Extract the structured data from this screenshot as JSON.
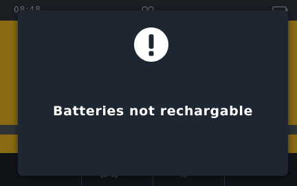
{
  "status_bar": {
    "time": "08:48",
    "icons": [
      "link-icon",
      "battery-icon"
    ]
  },
  "modal": {
    "icon": "exclamation-icon",
    "message": "Batteries not rechargable"
  },
  "colors": {
    "modal_background": "#1e2631",
    "icon_circle": "#ffffff",
    "icon_glyph": "#1e2631",
    "message_text": "#ffffff",
    "dimmed_accent": "#8a6b14"
  }
}
